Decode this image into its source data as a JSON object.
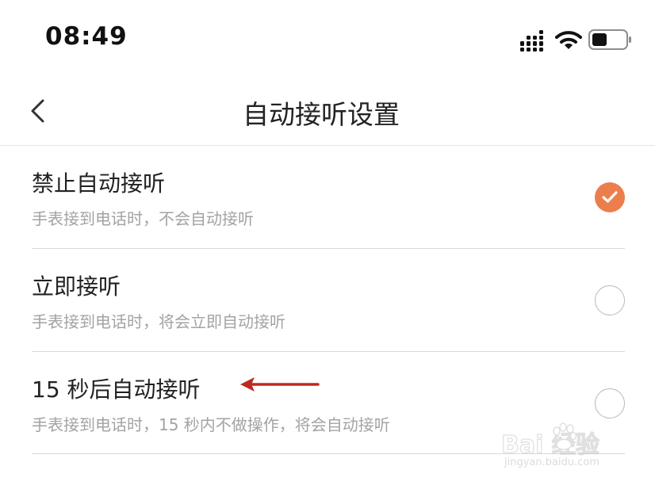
{
  "status_bar": {
    "time": "08:49",
    "signal_icon": "cellular-signal-icon",
    "wifi_icon": "wifi-icon",
    "battery_icon": "battery-icon",
    "battery_level": 0.45
  },
  "nav": {
    "back_icon": "chevron-left-icon",
    "title": "自动接听设置"
  },
  "options": [
    {
      "title": "禁止自动接听",
      "description": "手表接到电话时，不会自动接听",
      "selected": true
    },
    {
      "title": "立即接听",
      "description": "手表接到电话时，将会立即自动接听",
      "selected": false
    },
    {
      "title": "15 秒后自动接听",
      "description": "手表接到电话时，15 秒内不做操作，将会自动接听",
      "selected": false
    }
  ],
  "watermark": {
    "main": "Bai  经验",
    "sub": "jingyan.baidu.com"
  },
  "colors": {
    "accent": "#ec7e4e",
    "annotation_arrow": "#c0281f",
    "secondary_text": "#a3a3a3",
    "divider": "#d8d8d8"
  }
}
